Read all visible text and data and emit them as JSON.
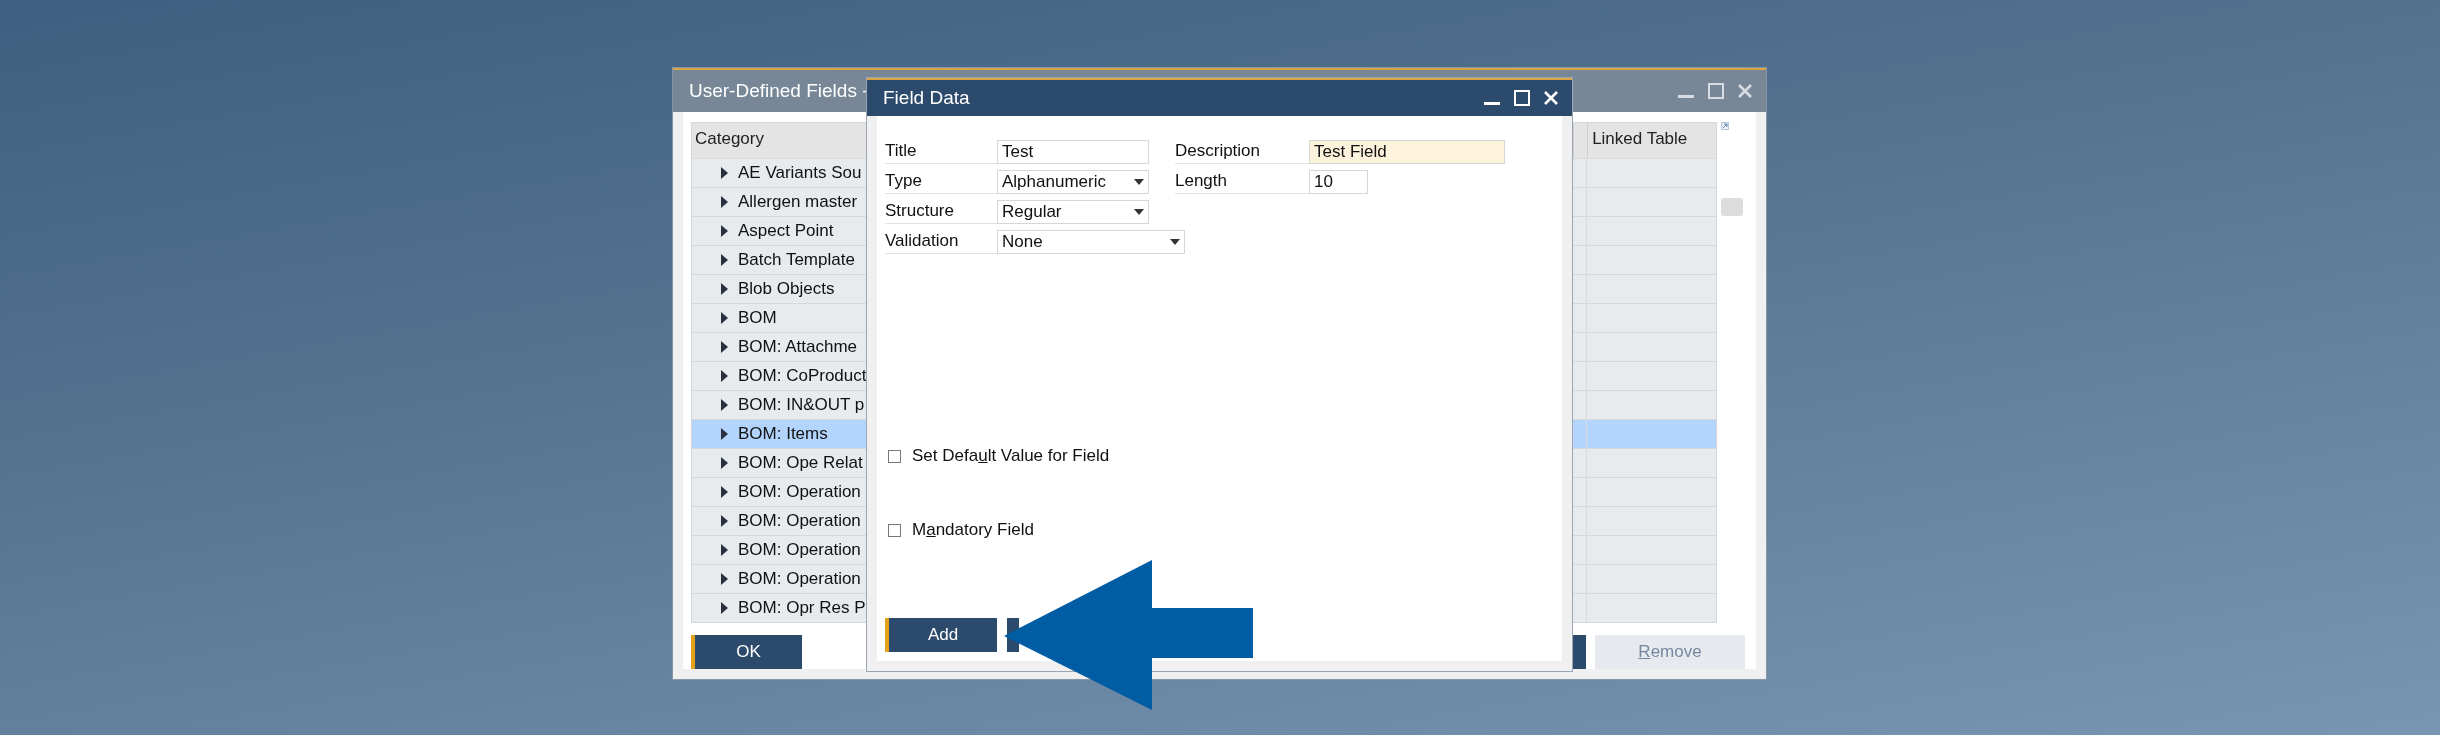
{
  "background_window": {
    "title": "User-Defined Fields -",
    "table": {
      "columns": [
        "Category",
        "Linked Table"
      ],
      "rows": [
        {
          "category": "AE Variants Sou",
          "selected": false
        },
        {
          "category": "Allergen master",
          "selected": false
        },
        {
          "category": "Aspect Point",
          "selected": false
        },
        {
          "category": "Batch Template",
          "selected": false
        },
        {
          "category": "Blob Objects",
          "selected": false
        },
        {
          "category": "BOM",
          "selected": false
        },
        {
          "category": "BOM: Attachme",
          "selected": false
        },
        {
          "category": "BOM: CoProduct",
          "selected": false
        },
        {
          "category": "BOM: IN&OUT p",
          "selected": false
        },
        {
          "category": "BOM: Items",
          "selected": true
        },
        {
          "category": "BOM: Ope Relat",
          "selected": false
        },
        {
          "category": "BOM: Operation",
          "selected": false
        },
        {
          "category": "BOM: Operation",
          "selected": false
        },
        {
          "category": "BOM: Operation",
          "selected": false
        },
        {
          "category": "BOM: Operation",
          "selected": false
        },
        {
          "category": "BOM: Opr Res P",
          "selected": false
        }
      ]
    },
    "ok_button": "OK",
    "remove_button": {
      "mnemonic": "R",
      "after": "emove",
      "disabled": true
    }
  },
  "field_data_window": {
    "title": "Field Data",
    "fields": [
      {
        "label": "Title",
        "value": "Test",
        "kind": "text"
      },
      {
        "label": "Description",
        "value": "Test Field",
        "kind": "text",
        "focused": true
      },
      {
        "label": "Type",
        "value": "Alphanumeric",
        "kind": "dropdown"
      },
      {
        "label": "Length",
        "value": "10",
        "kind": "text"
      },
      {
        "label": "Structure",
        "value": "Regular",
        "kind": "dropdown"
      },
      {
        "label": "Validation",
        "value": "None",
        "kind": "dropdown"
      }
    ],
    "checkboxes": [
      {
        "before": "Set Defa",
        "mnemonic": "u",
        "after": "lt Value for Field",
        "checked": false
      },
      {
        "before": "M",
        "mnemonic": "a",
        "after": "ndatory Field",
        "checked": false
      }
    ],
    "add_button": "Add"
  }
}
